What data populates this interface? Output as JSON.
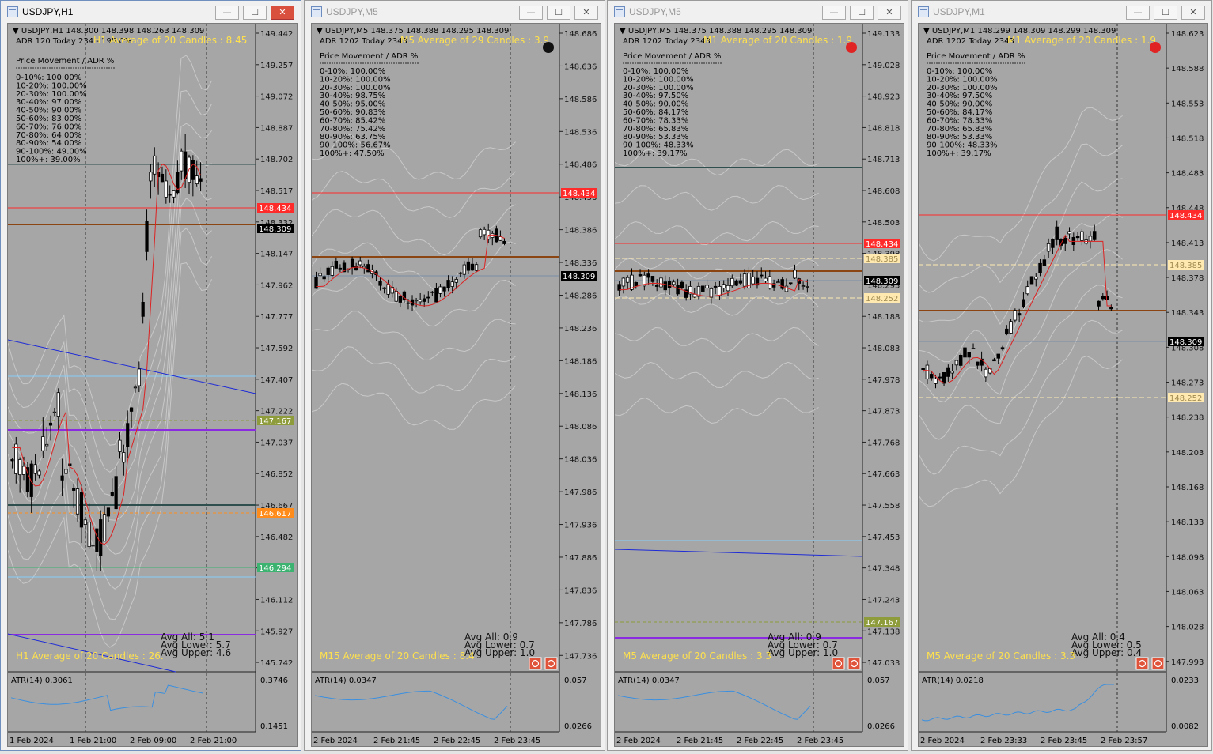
{
  "colors": {
    "background": "#a6a6a6",
    "grid_band": "#c8c8c8",
    "moving_average": "#dd2222",
    "level_red": "#ff2a2a",
    "level_brown": "#8b4513",
    "level_dark": "#2f4f4f",
    "level_purple": "#8a2be2",
    "level_blue": "#1e2bd6",
    "level_lightblue": "#87cefa",
    "level_green": "#3cb371",
    "level_orange": "#ff8c1a",
    "level_olive": "#8f9c3c",
    "level_cream": "#ffe9b0",
    "atr_line": "#3a8fe0",
    "yellow_text": "#ffe14d",
    "price_tag_black": "#111111"
  },
  "panels": [
    {
      "window_title": "USDJPY,H1",
      "active": true,
      "header_line": "USDJPY,H1  148.300 148.398 148.263 148.309",
      "adr_line": "ADR 120  Today 234 - 195.0%",
      "avg_label": "H1 Average of 20 Candles : 8.45",
      "bottom_avg_label": "H1 Average of 20 Candles : 26.",
      "price_movement_title": "Price Movement / ADR %",
      "price_movement": [
        "0-10%: 100.00%",
        "10-20%: 100.00%",
        "20-30%: 100.00%",
        "30-40%: 97.00%",
        "40-50%: 90.00%",
        "50-60%: 83.00%",
        "60-70%: 76.00%",
        "70-80%: 64.00%",
        "80-90%: 54.00%",
        "90-100%: 49.00%",
        "100%+: 39.00%"
      ],
      "stats": [
        "Avg All: 5.1",
        "Avg Lower: 5.7",
        "Avg Upper: 4.6"
      ],
      "price_axis": [
        "149.442",
        "149.257",
        "149.072",
        "148.887",
        "148.702",
        "148.517",
        "148.332",
        "148.147",
        "147.962",
        "147.777",
        "147.592",
        "147.407",
        "147.222",
        "147.037",
        "146.852",
        "146.667",
        "146.482",
        "146.297",
        "146.112",
        "145.927",
        "145.742"
      ],
      "price_tags": [
        {
          "price": "148.434",
          "kind": "red"
        },
        {
          "price": "148.309",
          "kind": "black"
        },
        {
          "price": "147.167",
          "kind": "olive"
        },
        {
          "price": "146.617",
          "kind": "orange"
        },
        {
          "price": "146.294",
          "kind": "green"
        }
      ],
      "atr_label": "ATR(14) 0.3061",
      "atr_axis": [
        "0.3746",
        "0.1451"
      ],
      "time_axis": [
        "1 Feb 2024",
        "1 Feb 21:00",
        "2 Feb 09:00",
        "2 Feb 21:00"
      ],
      "has_icons": false
    },
    {
      "window_title": "USDJPY,M5",
      "active": false,
      "header_line": "USDJPY,M5  148.375 148.388 148.295 148.309",
      "adr_line": "ADR 1202  Today 2343",
      "avg_label": "M5 Average of 29 Candles : 3.9",
      "bottom_avg_label": "M15 Average of 20 Candles : 8.4",
      "price_movement_title": "Price Movement / ADR %",
      "price_movement": [
        "0-10%: 100.00%",
        "10-20%: 100.00%",
        "20-30%: 100.00%",
        "30-40%: 98.75%",
        "40-50%: 95.00%",
        "50-60%: 90.83%",
        "60-70%: 85.42%",
        "70-80%: 75.42%",
        "80-90%: 63.75%",
        "90-100%: 56.67%",
        "100%+: 47.50%"
      ],
      "stats": [
        "Avg All: 0.9",
        "Avg Lower: 0.7",
        "Avg Upper: 1.0"
      ],
      "price_axis": [
        "148.686",
        "148.636",
        "148.586",
        "148.536",
        "148.486",
        "148.436",
        "148.386",
        "148.336",
        "148.286",
        "148.236",
        "148.186",
        "148.136",
        "148.086",
        "148.036",
        "147.986",
        "147.936",
        "147.886",
        "147.836",
        "147.786",
        "147.736"
      ],
      "price_tags": [
        {
          "price": "148.434",
          "kind": "red"
        },
        {
          "price": "148.309",
          "kind": "black"
        }
      ],
      "atr_label": "ATR(14) 0.0347",
      "atr_axis": [
        "0.057",
        "0.0266"
      ],
      "time_axis": [
        "2 Feb 2024",
        "2 Feb 21:45",
        "2 Feb 22:45",
        "2 Feb 23:45"
      ],
      "has_icons": true
    },
    {
      "window_title": "USDJPY,M5",
      "active": false,
      "header_line": "USDJPY,M5  148.375 148.388 148.295 148.309",
      "adr_line": "ADR 1202  Today 2343",
      "avg_label": "M1 Average of 20 Candles : 1.9",
      "bottom_avg_label": "M5 Average of 20 Candles : 3.3",
      "price_movement_title": "Price Movement / ADR %",
      "price_movement": [
        "0-10%: 100.00%",
        "10-20%: 100.00%",
        "20-30%: 100.00%",
        "30-40%: 97.50%",
        "40-50%: 90.00%",
        "50-60%: 84.17%",
        "60-70%: 78.33%",
        "70-80%: 65.83%",
        "80-90%: 53.33%",
        "90-100%: 48.33%",
        "100%+: 39.17%"
      ],
      "stats": [
        "Avg All: 0.9",
        "Avg Lower: 0.7",
        "Avg Upper: 1.0"
      ],
      "price_axis": [
        "149.133",
        "149.028",
        "148.923",
        "148.818",
        "148.713",
        "148.608",
        "148.503",
        "148.398",
        "148.293",
        "148.188",
        "148.083",
        "147.978",
        "147.873",
        "147.768",
        "147.663",
        "147.558",
        "147.453",
        "147.348",
        "147.243",
        "147.138",
        "147.033"
      ],
      "price_tags": [
        {
          "price": "148.434",
          "kind": "red"
        },
        {
          "price": "148.385",
          "kind": "cream"
        },
        {
          "price": "148.309",
          "kind": "black"
        },
        {
          "price": "148.252",
          "kind": "cream"
        },
        {
          "price": "147.167",
          "kind": "olive"
        }
      ],
      "atr_label": "ATR(14) 0.0347",
      "atr_axis": [
        "0.057",
        "0.0266"
      ],
      "time_axis": [
        "2 Feb 2024",
        "2 Feb 21:45",
        "2 Feb 22:45",
        "2 Feb 23:45"
      ],
      "has_icons": true
    },
    {
      "window_title": "USDJPY,M1",
      "active": false,
      "header_line": "USDJPY,M1  148.299 148.309 148.299 148.309",
      "adr_line": "ADR 1202  Today 2343",
      "avg_label": "M1 Average of 20 Candles : 1.9",
      "bottom_avg_label": "M5 Average of 20 Candles : 3.3",
      "price_movement_title": "Price Movement / ADR %",
      "price_movement": [
        "0-10%: 100.00%",
        "10-20%: 100.00%",
        "20-30%: 100.00%",
        "30-40%: 97.50%",
        "40-50%: 90.00%",
        "50-60%: 84.17%",
        "60-70%: 78.33%",
        "70-80%: 65.83%",
        "80-90%: 53.33%",
        "90-100%: 48.33%",
        "100%+: 39.17%"
      ],
      "stats": [
        "Avg All: 0.4",
        "Avg Lower: 0.5",
        "Avg Upper: 0.4"
      ],
      "price_axis": [
        "148.623",
        "148.588",
        "148.553",
        "148.518",
        "148.483",
        "148.448",
        "148.413",
        "148.378",
        "148.343",
        "148.308",
        "148.273",
        "148.238",
        "148.203",
        "148.168",
        "148.133",
        "148.098",
        "148.063",
        "148.028",
        "147.993"
      ],
      "price_tags": [
        {
          "price": "148.434",
          "kind": "red"
        },
        {
          "price": "148.385",
          "kind": "cream"
        },
        {
          "price": "148.309",
          "kind": "black"
        },
        {
          "price": "148.252",
          "kind": "cream"
        }
      ],
      "atr_label": "ATR(14) 0.0218",
      "atr_axis": [
        "0.0233",
        "0.0082"
      ],
      "time_axis": [
        "2 Feb 2024",
        "2 Feb 23:33",
        "2 Feb 23:45",
        "2 Feb 23:57"
      ],
      "has_icons": true
    }
  ]
}
